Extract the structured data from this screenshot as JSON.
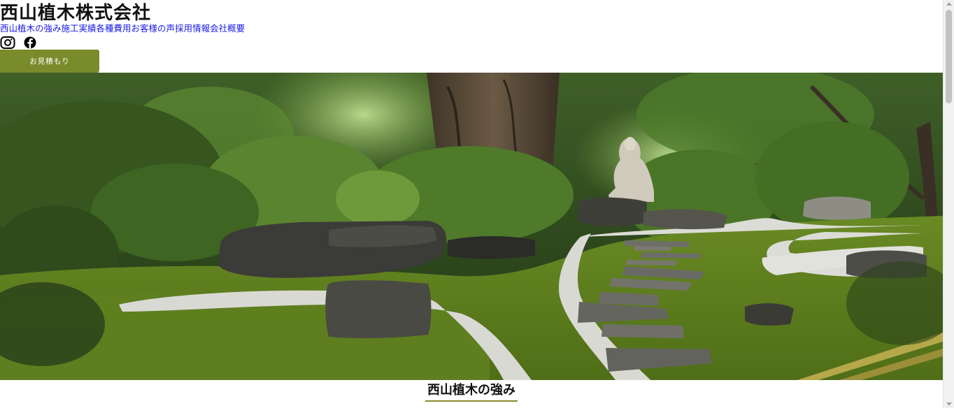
{
  "header": {
    "site_title": "西山植木株式会社",
    "nav": [
      {
        "label": "西山植木の強み"
      },
      {
        "label": "施工実績"
      },
      {
        "label": "各種費用"
      },
      {
        "label": "お客様の声"
      },
      {
        "label": "採用情報"
      },
      {
        "label": "会社概要"
      }
    ],
    "social_icons": [
      "instagram-icon",
      "facebook-icon"
    ],
    "quote_button_label": "お見積もり"
  },
  "hero": {
    "image_subject": "japanese-garden-photo"
  },
  "main": {
    "section_heading": "西山植木の強み"
  },
  "colors": {
    "accent_olive": "#7a8b2b",
    "nav_link_blue": "#1a1ae6",
    "heading_underline": "#8a8a2a"
  }
}
